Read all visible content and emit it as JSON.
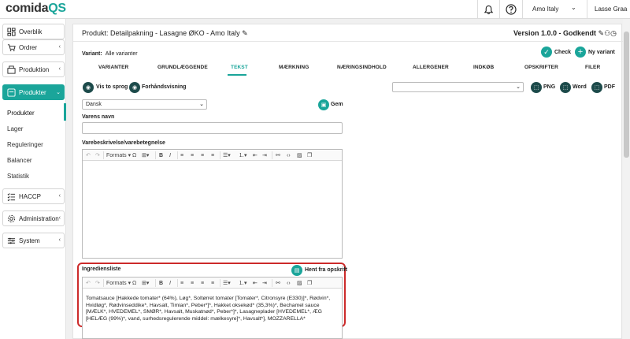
{
  "app": {
    "logo_main": "comida",
    "logo_accent": "QS"
  },
  "topbar": {
    "company": "Amo Italy",
    "user": "Lasse Graa"
  },
  "sidebar": {
    "items": [
      {
        "label": "Overblik"
      },
      {
        "label": "Ordrer"
      },
      {
        "label": "Produktion"
      },
      {
        "label": "Produkter"
      },
      {
        "label": "HACCP"
      },
      {
        "label": "Administration"
      },
      {
        "label": "System"
      }
    ],
    "subitems": [
      {
        "label": "Produkter"
      },
      {
        "label": "Lager"
      },
      {
        "label": "Reguleringer"
      },
      {
        "label": "Balancer"
      },
      {
        "label": "Statistik"
      }
    ]
  },
  "header": {
    "title": "Produkt: Detailpakning - Lasagne ØKO - Amo Italy",
    "version": "Version 1.0.0 - Godkendt"
  },
  "variant": {
    "label": "Variant:",
    "value": "Alle varianter"
  },
  "actions": {
    "check": "Check",
    "new_variant": "Ny variant"
  },
  "tabs": [
    "VARIANTER",
    "GRUNDLÆGGENDE",
    "TEKST",
    "MÆRKNING",
    "NÆRINGSINDHOLD",
    "ALLERGENER",
    "INDKØB",
    "OPSKRIFTER",
    "FILER"
  ],
  "controls": {
    "show_language": "Vis to sprog",
    "preview": "Forhåndsvisning",
    "language": "Dansk",
    "save": "Gem",
    "png": "PNG",
    "word": "Word",
    "pdf": "PDF"
  },
  "fields": {
    "name_label": "Varens navn",
    "description_label": "Varebeskrivelse/varebetegnelse",
    "ingredients_label": "Ingrediensliste",
    "fetch_recipe": "Hent fra opskrift",
    "ingredients_text": "Tomatsauce [Hakkede tomater* (64%), Løg*, Soltørret tomater [Tomater*, Citronsyre (E330)]*, Rødvin*, Hvidløg*, Rødvinseddike*, Havsalt, Timian*, Peber*]*, Hakket oksekød* (35,3%)*, Bechamel sauce [MÆLK*, HVEDEMEL*, SMØR*, Havsalt, Muskatnød*, Peber*]*, Lasagneplader [HVEDEMEL*, ÆG [HELÆG (99%)*, vand, surhedsregulerende middel: mælkesyre]*, Havsalt*], MOZZARELLA*"
  },
  "editor_toolbar": {
    "formats": "Formats"
  }
}
